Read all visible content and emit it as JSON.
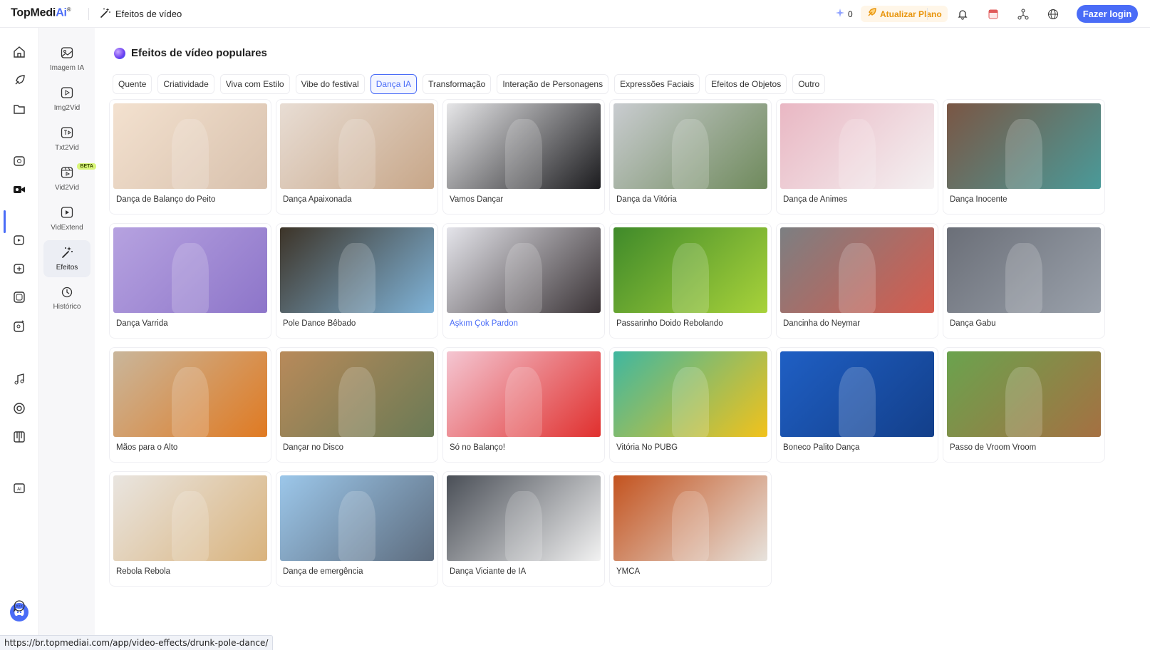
{
  "app": {
    "logo_text": "TopMedi",
    "logo_accent": "Ai",
    "logo_mark": "®",
    "page_title": "Efeitos de vídeo"
  },
  "topbar": {
    "credits": "0",
    "upgrade_label": "Atualizar Plano",
    "login_label": "Fazer login"
  },
  "rail": {
    "icons": [
      "home-icon",
      "rocket-icon",
      "folder-icon",
      "ai-image-icon",
      "video-camera-icon",
      "video-enhance-icon",
      "video-sound-icon",
      "video-translate-icon",
      "photo-edit-icon",
      "music-note-icon",
      "record-icon",
      "piano-icon",
      "ai-badge-icon"
    ]
  },
  "subnav": [
    {
      "label": "Imagem IA",
      "icon": "image-icon"
    },
    {
      "label": "Img2Vid",
      "icon": "img2vid-icon"
    },
    {
      "label": "Txt2Vid",
      "icon": "txt2vid-icon"
    },
    {
      "label": "Vid2Vid",
      "icon": "vid2vid-icon",
      "badge": "BETA"
    },
    {
      "label": "VidExtend",
      "icon": "vidextend-icon"
    },
    {
      "label": "Efeitos",
      "icon": "magic-wand-icon",
      "active": true
    },
    {
      "label": "Histórico",
      "icon": "history-icon"
    }
  ],
  "section_title": "Efeitos de vídeo populares",
  "tabs": [
    "Quente",
    "Criatividade",
    "Viva com Estilo",
    "Vibe do festival",
    "Dança IA",
    "Transformação",
    "Interação de Personagens",
    "Expressões Faciais",
    "Efeitos de Objetos",
    "Outro"
  ],
  "active_tab": "Dança IA",
  "cards": [
    {
      "label": "Dança de Balanço do Peito",
      "c1": "#f3e1cf",
      "c2": "#d8c1ad"
    },
    {
      "label": "Dança Apaixonada",
      "c1": "#e8ddd4",
      "c2": "#c7a688"
    },
    {
      "label": "Vamos Dançar",
      "c1": "#e6e6e8",
      "c2": "#1c1c1f"
    },
    {
      "label": "Dança da Vitória",
      "c1": "#c9ccd0",
      "c2": "#6f8a5c"
    },
    {
      "label": "Dança de Animes",
      "c1": "#e9b7c3",
      "c2": "#f4f1f2"
    },
    {
      "label": "Dança Inocente",
      "c1": "#7a5644",
      "c2": "#4a9a99"
    },
    {
      "label": "Dança Varrida",
      "c1": "#b6a2e0",
      "c2": "#8d75c9"
    },
    {
      "label": "Pole Dance Bêbado",
      "c1": "#3d3428",
      "c2": "#7fb3d8"
    },
    {
      "label": "Aşkım Çok Pardon",
      "c1": "#e4e4ea",
      "c2": "#3a3336"
    },
    {
      "label": "Passarinho Doido Rebolando",
      "c1": "#3f8a2a",
      "c2": "#a8d23a"
    },
    {
      "label": "Dancinha do Neymar",
      "c1": "#7c7f82",
      "c2": "#d65b4d"
    },
    {
      "label": "Dança Gabu",
      "c1": "#6b6f78",
      "c2": "#9aa1ab"
    },
    {
      "label": "Mãos para o Alto",
      "c1": "#c9b69b",
      "c2": "#e07a22"
    },
    {
      "label": "Dançar no Disco",
      "c1": "#b88a5a",
      "c2": "#6a7a55"
    },
    {
      "label": "Só no Balanço!",
      "c1": "#f4c6d2",
      "c2": "#e0302e"
    },
    {
      "label": "Vitória No PUBG",
      "c1": "#3fb7a0",
      "c2": "#f2c21b"
    },
    {
      "label": "Boneco Palito Dança",
      "c1": "#1f5fc4",
      "c2": "#133f8a"
    },
    {
      "label": "Passo de Vroom Vroom",
      "c1": "#6aa34e",
      "c2": "#a57042"
    },
    {
      "label": "Rebola Rebola",
      "c1": "#e9e5e0",
      "c2": "#d9b37d"
    },
    {
      "label": "Dança de emergência",
      "c1": "#9cc7ea",
      "c2": "#5d6c7e"
    },
    {
      "label": "Dança Viciante de IA",
      "c1": "#4a4f57",
      "c2": "#f2f2f2"
    },
    {
      "label": "YMCA",
      "c1": "#c3531f",
      "c2": "#e7e3dd"
    }
  ],
  "hovered_card": "Aşkım Çok Pardon",
  "status_url": "https://br.topmediai.com/app/video-effects/drunk-pole-dance/",
  "colors": {
    "accent": "#4a6cf7",
    "upgrade": "#e8950d"
  }
}
